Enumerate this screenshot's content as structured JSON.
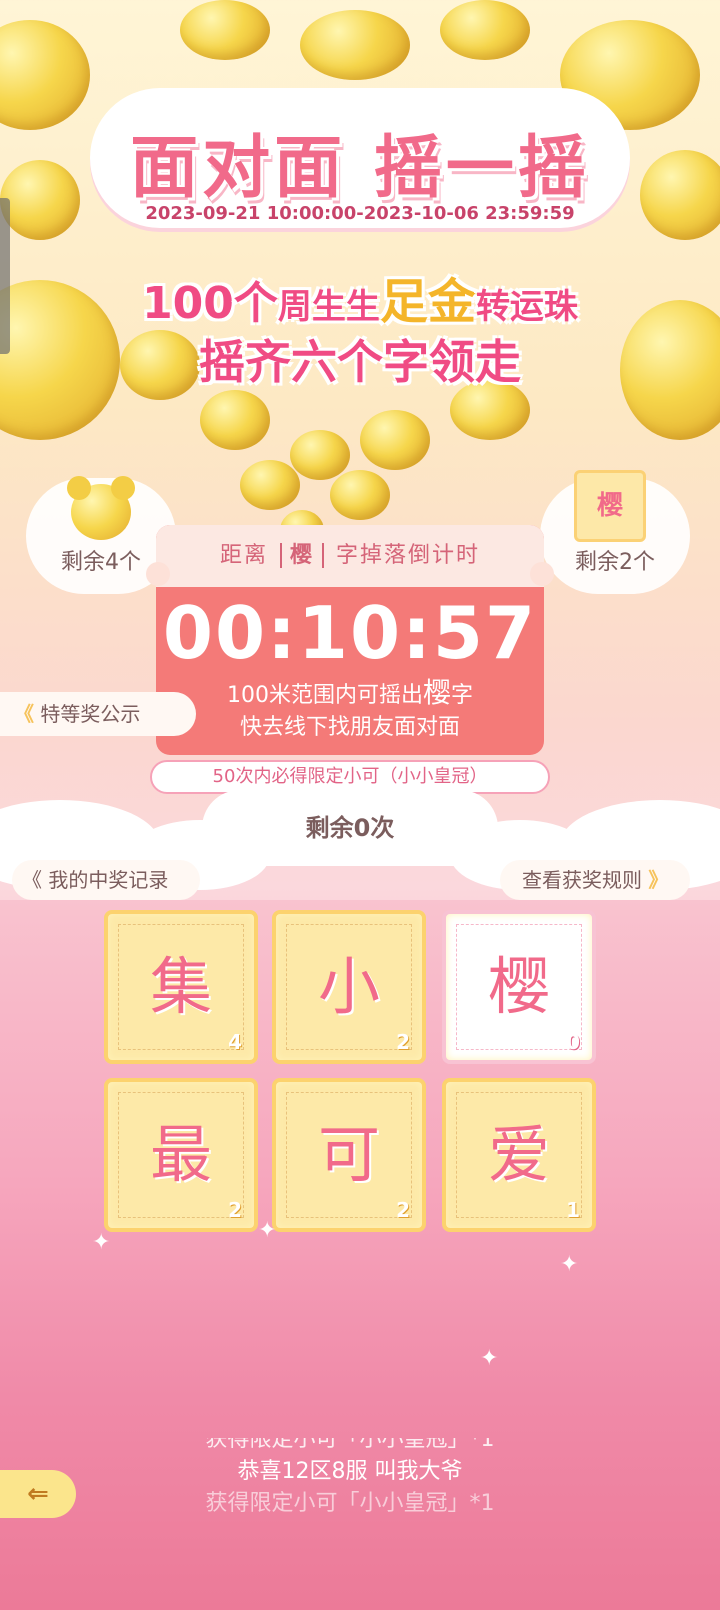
{
  "header": {
    "title": "面对面 摇一摇",
    "date_range": "2023-09-21 10:00:00-2023-10-06 23:59:59",
    "promo_num": "100",
    "promo_ge": "个",
    "promo_brand": "周生生",
    "promo_gold": "足金",
    "promo_item": "转运珠",
    "promo_line2": "摇齐六个字领走"
  },
  "side": {
    "left_remaining": "剩余4个",
    "right_char": "樱",
    "right_remaining": "剩余2个"
  },
  "countdown": {
    "prefix": "距离",
    "char": "樱",
    "suffix": "字掉落倒计时",
    "time": "00:10:57",
    "hint_prefix": "100米范围内可摇出",
    "hint_char": "樱",
    "hint_suffix": "字",
    "hint_line2": "快去线下找朋友面对面"
  },
  "special_prize_label": "特等奖公示",
  "guarantee_text": "50次内必得限定小可（小小皇冠）",
  "remaining_times": "剩余0次",
  "record_label": "我的中奖记录",
  "rules_label": "查看获奖规则",
  "tiles": [
    {
      "char": "集",
      "count": "4",
      "empty": false
    },
    {
      "char": "小",
      "count": "2",
      "empty": false
    },
    {
      "char": "樱",
      "count": "0",
      "empty": true
    },
    {
      "char": "最",
      "count": "2",
      "empty": false
    },
    {
      "char": "可",
      "count": "2",
      "empty": false
    },
    {
      "char": "爱",
      "count": "1",
      "empty": false
    }
  ],
  "ticker": {
    "line1": "获得限定小可「小小皇冠」*1",
    "line2": "恭喜12区8服 叫我大爷",
    "line3": "获得限定小可「小小皇冠」*1"
  },
  "icons": {
    "back": "back-arrow-icon",
    "chevrons": "double-chevron-icon"
  },
  "colors": {
    "accent_pink": "#f16a8a",
    "countdown_red": "#f47a78",
    "gold": "#f4b52a"
  }
}
